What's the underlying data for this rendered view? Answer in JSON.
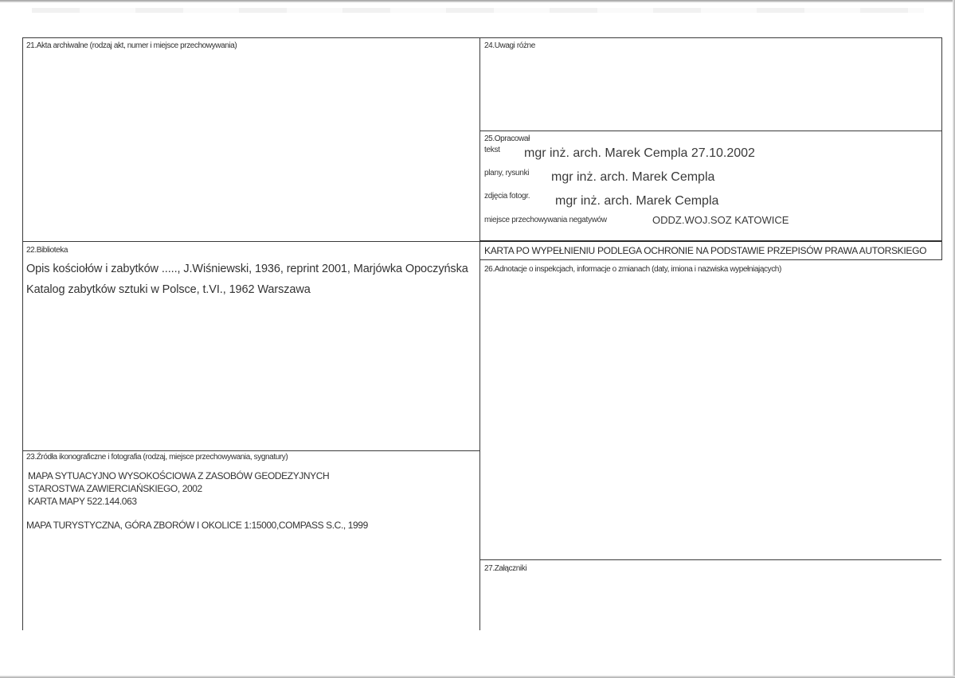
{
  "sections": {
    "s21": {
      "label": "21.Akta archiwalne (rodzaj akt, numer i miejsce przechowywania)"
    },
    "s22": {
      "label": "22.Biblioteka",
      "entries": [
        "Opis kościołów i zabytków ....., J.Wiśniewski, 1936,  reprint 2001, Marjówka Opoczyńska",
        "Katalog zabytków sztuki w Polsce, t.VI., 1962 Warszawa"
      ]
    },
    "s23": {
      "label": "23.Źródła  ikonograficzne i fotografia (rodzaj, miejsce przechowywania, sygnatury)",
      "lines": [
        "MAPA SYTUACYJNO WYSOKOŚCIOWA Z ZASOBÓW GEODEZYJNYCH",
        "STAROSTWA ZAWIERCIAŃSKIEGO, 2002",
        "KARTA MAPY 522.144.063"
      ],
      "extra": "MAPA TURYSTYCZNA, GÓRA ZBORÓW I OKOLICE 1:15000,COMPASS S.C., 1999"
    },
    "s24": {
      "label": "24.Uwagi różne"
    },
    "s25": {
      "label": "25.Opracował",
      "tekst_tag": "tekst",
      "tekst_value": "mgr inż. arch. Marek Cempla  27.10.2002",
      "plany_tag": "plany, rysunki",
      "plany_value": "mgr inż. arch. Marek Cempla",
      "zdjecia_tag": "zdjęcia fotogr.",
      "zdjecia_value": "mgr inż. arch. Marek Cempla",
      "negatywy_tag": "miejsce przechowywania negatywów",
      "negatywy_value": "ODDZ.WOJ.SOZ KATOWICE"
    },
    "notice": "KARTA PO WYPEŁNIENIU PODLEGA OCHRONIE NA PODSTAWIE PRZEPISÓW PRAWA AUTORSKIEGO",
    "s26": {
      "label": "26.Adnotacje o inspekcjach, informacje o zmianach (daty, imiona i nazwiska wypełniających)"
    },
    "s27": {
      "label": "27.Załączniki"
    }
  }
}
